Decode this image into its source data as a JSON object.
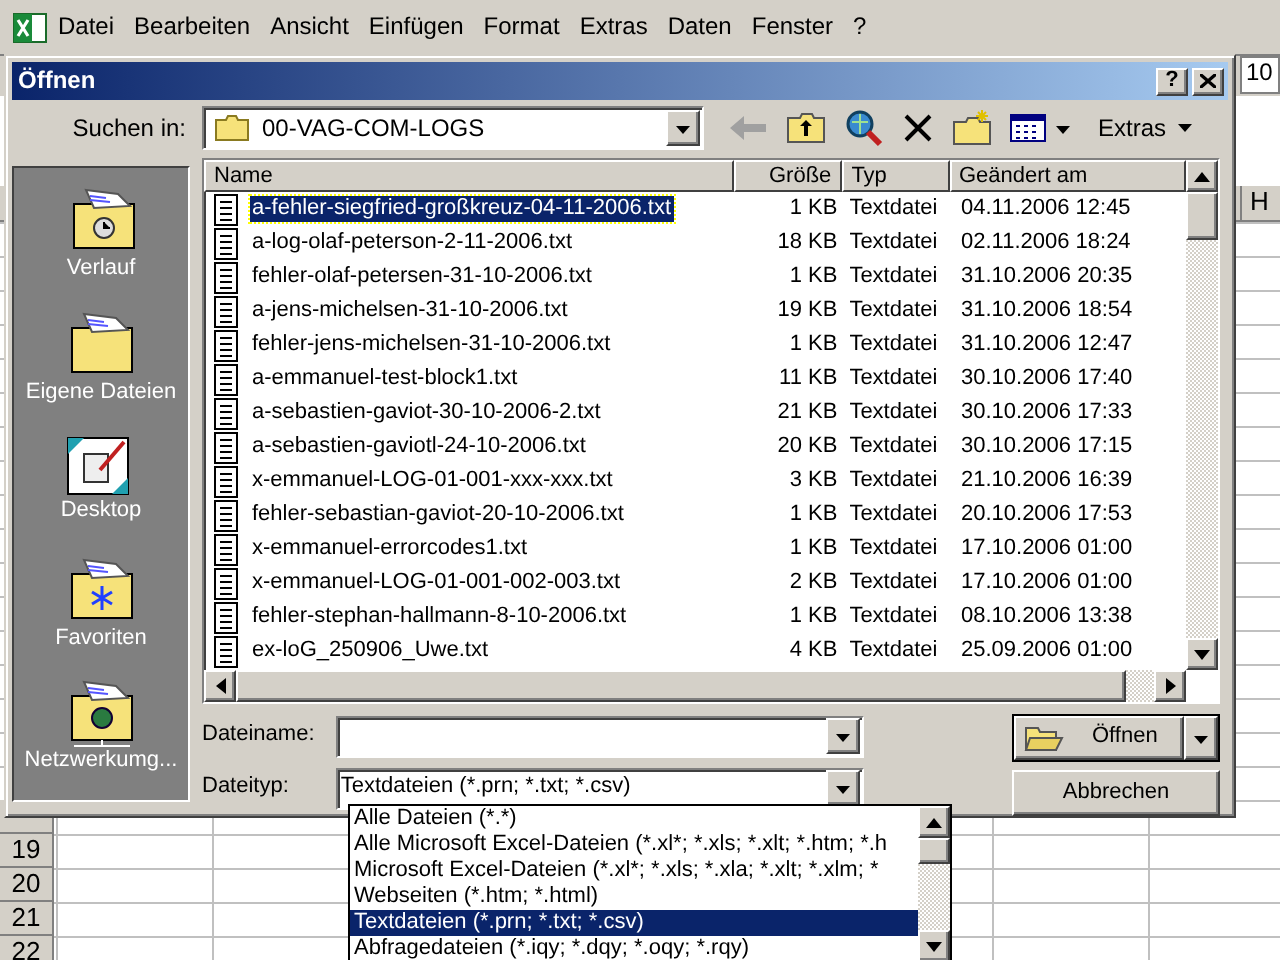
{
  "menu": [
    "Datei",
    "Bearbeiten",
    "Ansicht",
    "Einfügen",
    "Format",
    "Extras",
    "Daten",
    "Fenster",
    "?"
  ],
  "font_size": "10",
  "column_header": "H",
  "row_headers": [
    "19",
    "20",
    "21",
    "22"
  ],
  "dialog": {
    "title": "Öffnen",
    "help_button": "?",
    "look_in_label": "Suchen in:",
    "look_in_value": "00-VAG-COM-LOGS",
    "extras_label": "Extras",
    "places": [
      {
        "label": "Verlauf",
        "kind": "history"
      },
      {
        "label": "Eigene Dateien",
        "kind": "folder"
      },
      {
        "label": "Desktop",
        "kind": "desktop"
      },
      {
        "label": "Favoriten",
        "kind": "favorites"
      },
      {
        "label": "Netzwerkumg...",
        "kind": "network"
      }
    ],
    "columns": [
      "Name",
      "Größe",
      "Typ",
      "Geändert am"
    ],
    "files": [
      {
        "name": "a-fehler-siegfried-großkreuz-04-11-2006.txt",
        "size": "1 KB",
        "type": "Textdatei",
        "modified": "04.11.2006 12:45",
        "selected": true
      },
      {
        "name": "a-log-olaf-peterson-2-11-2006.txt",
        "size": "18 KB",
        "type": "Textdatei",
        "modified": "02.11.2006 18:24",
        "selected": false
      },
      {
        "name": "fehler-olaf-petersen-31-10-2006.txt",
        "size": "1 KB",
        "type": "Textdatei",
        "modified": "31.10.2006 20:35",
        "selected": false
      },
      {
        "name": "a-jens-michelsen-31-10-2006.txt",
        "size": "19 KB",
        "type": "Textdatei",
        "modified": "31.10.2006 18:54",
        "selected": false
      },
      {
        "name": "fehler-jens-michelsen-31-10-2006.txt",
        "size": "1 KB",
        "type": "Textdatei",
        "modified": "31.10.2006 12:47",
        "selected": false
      },
      {
        "name": "a-emmanuel-test-block1.txt",
        "size": "11 KB",
        "type": "Textdatei",
        "modified": "30.10.2006 17:40",
        "selected": false
      },
      {
        "name": "a-sebastien-gaviot-30-10-2006-2.txt",
        "size": "21 KB",
        "type": "Textdatei",
        "modified": "30.10.2006 17:33",
        "selected": false
      },
      {
        "name": "a-sebastien-gaviotl-24-10-2006.txt",
        "size": "20 KB",
        "type": "Textdatei",
        "modified": "30.10.2006 17:15",
        "selected": false
      },
      {
        "name": "x-emmanuel-LOG-01-001-xxx-xxx.txt",
        "size": "3 KB",
        "type": "Textdatei",
        "modified": "21.10.2006 16:39",
        "selected": false
      },
      {
        "name": "fehler-sebastian-gaviot-20-10-2006.txt",
        "size": "1 KB",
        "type": "Textdatei",
        "modified": "20.10.2006 17:53",
        "selected": false
      },
      {
        "name": "x-emmanuel-errorcodes1.txt",
        "size": "1 KB",
        "type": "Textdatei",
        "modified": "17.10.2006 01:00",
        "selected": false
      },
      {
        "name": "x-emmanuel-LOG-01-001-002-003.txt",
        "size": "2 KB",
        "type": "Textdatei",
        "modified": "17.10.2006 01:00",
        "selected": false
      },
      {
        "name": "fehler-stephan-hallmann-8-10-2006.txt",
        "size": "1 KB",
        "type": "Textdatei",
        "modified": "08.10.2006 13:38",
        "selected": false
      },
      {
        "name": "ex-loG_250906_Uwe.txt",
        "size": "4 KB",
        "type": "Textdatei",
        "modified": "25.09.2006 01:00",
        "selected": false
      }
    ],
    "filename_label": "Dateiname:",
    "filetype_label": "Dateityp:",
    "filetype_value": "Textdateien (*.prn; *.txt; *.csv)",
    "filetype_options": [
      {
        "label": "Alle Dateien (*.*)",
        "selected": false
      },
      {
        "label": "Alle Microsoft Excel-Dateien (*.xl*; *.xls; *.xlt; *.htm; *.h",
        "selected": false
      },
      {
        "label": "Microsoft Excel-Dateien (*.xl*; *.xls; *.xla; *.xlt; *.xlm; *",
        "selected": false
      },
      {
        "label": "Webseiten (*.htm; *.html)",
        "selected": false
      },
      {
        "label": "Textdateien (*.prn; *.txt; *.csv)",
        "selected": true
      },
      {
        "label": "Abfragedateien (*.iqy; *.dqy; *.oqy; *.rqy)",
        "selected": false
      }
    ],
    "open_button": "Öffnen",
    "cancel_button": "Abbrechen"
  }
}
